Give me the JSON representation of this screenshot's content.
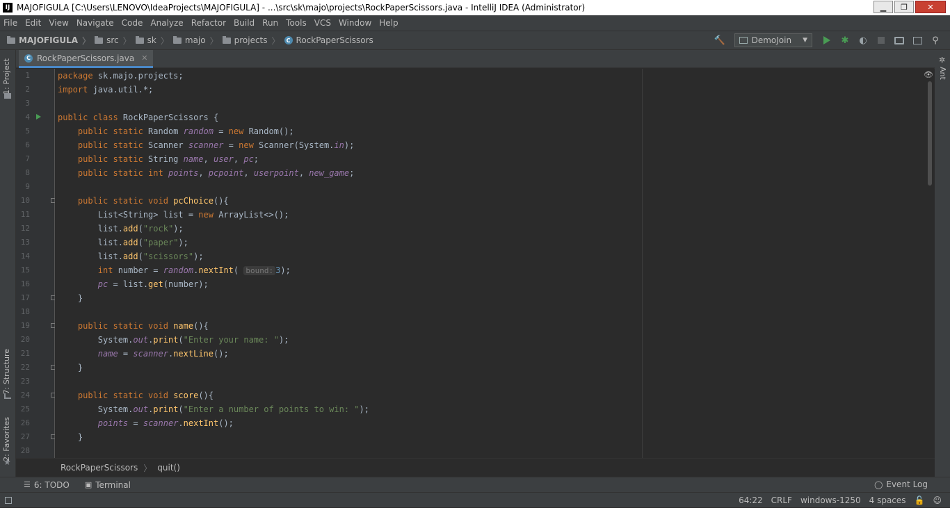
{
  "window": {
    "title": "MAJOFIGULA [C:\\Users\\LENOVO\\IdeaProjects\\MAJOFIGULA] - ...\\src\\sk\\majo\\projects\\RockPaperScissors.java - IntelliJ IDEA (Administrator)",
    "logo": "IJ",
    "minimize": "▁",
    "restore": "❐",
    "close": "✕"
  },
  "menu": [
    "File",
    "Edit",
    "View",
    "Navigate",
    "Code",
    "Analyze",
    "Refactor",
    "Build",
    "Run",
    "Tools",
    "VCS",
    "Window",
    "Help"
  ],
  "nav": {
    "crumbs": [
      "MAJOFIGULA",
      "src",
      "sk",
      "majo",
      "projects",
      "RockPaperScissors"
    ],
    "run_config": "DemoJoin"
  },
  "tabs": [
    {
      "label": "RockPaperScissors.java",
      "close": "✕"
    }
  ],
  "side": {
    "project": "1: Project",
    "structure": "7: Structure",
    "favorites": "2: Favorites",
    "ant": "Ant"
  },
  "code": {
    "line_numbers": [
      "1",
      "2",
      "3",
      "4",
      "5",
      "6",
      "7",
      "8",
      "9",
      "10",
      "11",
      "12",
      "13",
      "14",
      "15",
      "16",
      "17",
      "18",
      "19",
      "20",
      "21",
      "22",
      "23",
      "24",
      "25",
      "26",
      "27",
      "28"
    ],
    "hint": "bound:"
  },
  "breadcrumbs": {
    "class": "RockPaperScissors",
    "method": "quit()"
  },
  "toolwindows": {
    "todo": "6: TODO",
    "terminal": "Terminal",
    "event_log": "Event Log"
  },
  "status": {
    "position": "64:22",
    "line_sep": "CRLF",
    "encoding": "windows-1250",
    "indent": "4 spaces"
  },
  "colors": {
    "keyword": "#cc7832",
    "field": "#9876aa",
    "method": "#ffc66d",
    "string": "#6a8759",
    "number": "#6897bb",
    "run": "#499c54"
  }
}
